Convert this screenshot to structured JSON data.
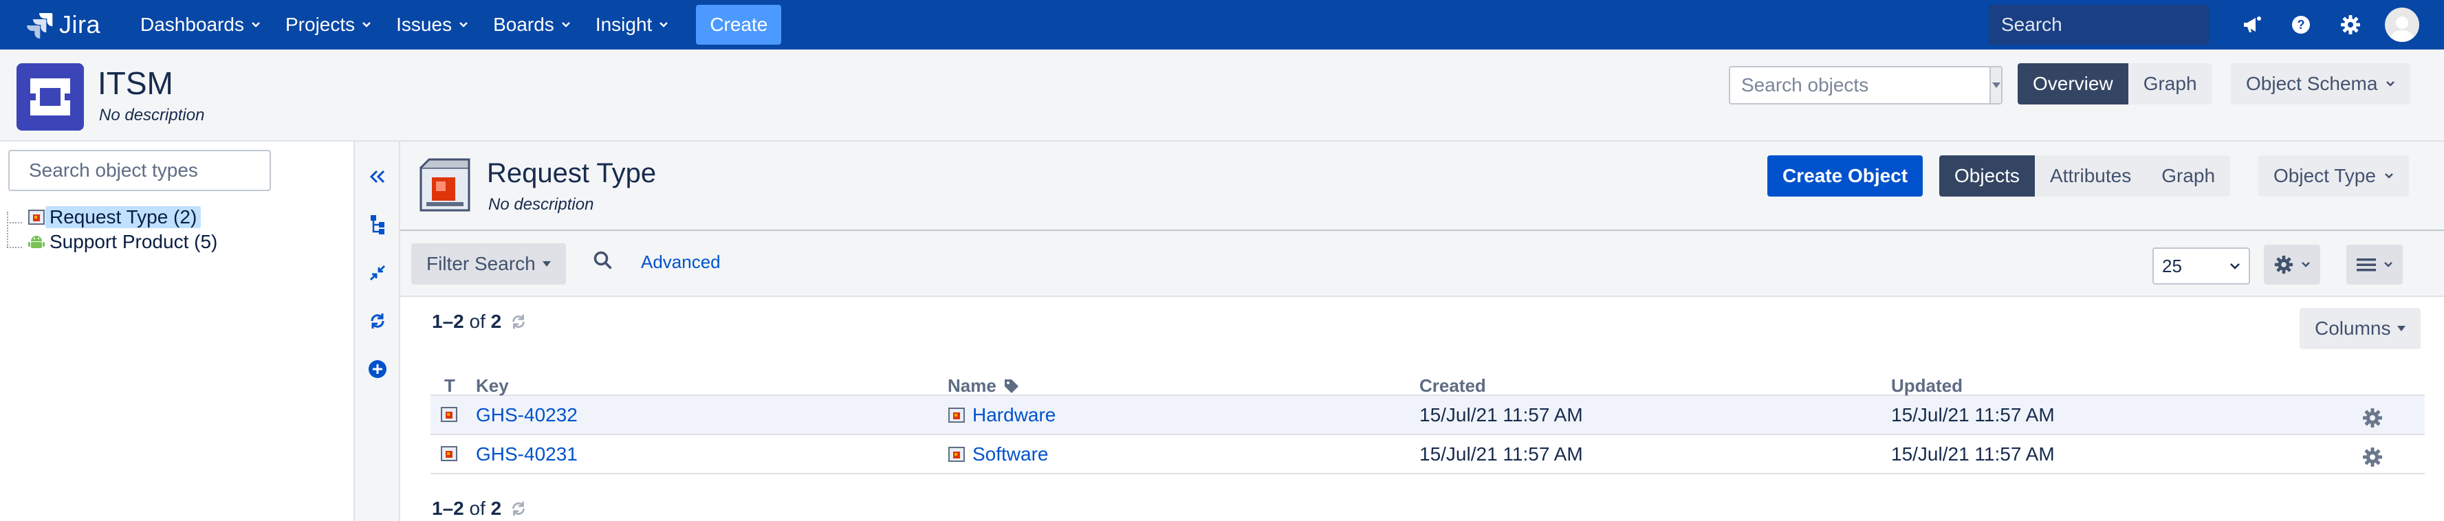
{
  "nav": {
    "logo_text": "Jira",
    "items": [
      {
        "label": "Dashboards"
      },
      {
        "label": "Projects"
      },
      {
        "label": "Issues"
      },
      {
        "label": "Boards"
      },
      {
        "label": "Insight"
      }
    ],
    "create_label": "Create",
    "search_placeholder": "Search",
    "icons": [
      "megaphone-icon",
      "help-icon",
      "settings-icon",
      "avatar"
    ]
  },
  "schema": {
    "title": "ITSM",
    "description": "No description",
    "search_placeholder": "Search objects",
    "overview_label": "Overview",
    "graph_label": "Graph",
    "object_schema_label": "Object Schema"
  },
  "sidebar": {
    "search_placeholder": "Search object types",
    "tree": [
      {
        "label": "Request Type (2)",
        "icon": "request-type-icon",
        "selected": true
      },
      {
        "label": "Support Product (5)",
        "icon": "android-icon",
        "selected": false
      }
    ],
    "tools": [
      "collapse-icon",
      "tree-structure-icon",
      "minimize-icon",
      "refresh-icon",
      "add-circle-icon"
    ]
  },
  "object_type": {
    "title": "Request Type",
    "description": "No description",
    "create_object_label": "Create Object",
    "tabs": [
      {
        "label": "Objects",
        "active": true
      },
      {
        "label": "Attributes",
        "active": false
      },
      {
        "label": "Graph",
        "active": false
      }
    ],
    "object_type_label": "Object Type"
  },
  "filter": {
    "filter_search_label": "Filter Search",
    "advanced_label": "Advanced",
    "page_size": "25"
  },
  "results": {
    "range": "1–2",
    "of_text": "of",
    "total": "2",
    "columns_label": "Columns",
    "headers": {
      "type": "T",
      "key": "Key",
      "name": "Name",
      "created": "Created",
      "updated": "Updated"
    },
    "rows": [
      {
        "key": "GHS-40232",
        "name": "Hardware",
        "created": "15/Jul/21 11:57 AM",
        "updated": "15/Jul/21 11:57 AM"
      },
      {
        "key": "GHS-40231",
        "name": "Software",
        "created": "15/Jul/21 11:57 AM",
        "updated": "15/Jul/21 11:57 AM"
      }
    ]
  },
  "colors": {
    "nav_bg": "#0747a6",
    "create_btn": "#4c9aff",
    "primary": "#0052cc",
    "dark_btn": "#344563",
    "selected_tree": "#bfe1ff",
    "schema_icon": "#3b45b8"
  }
}
